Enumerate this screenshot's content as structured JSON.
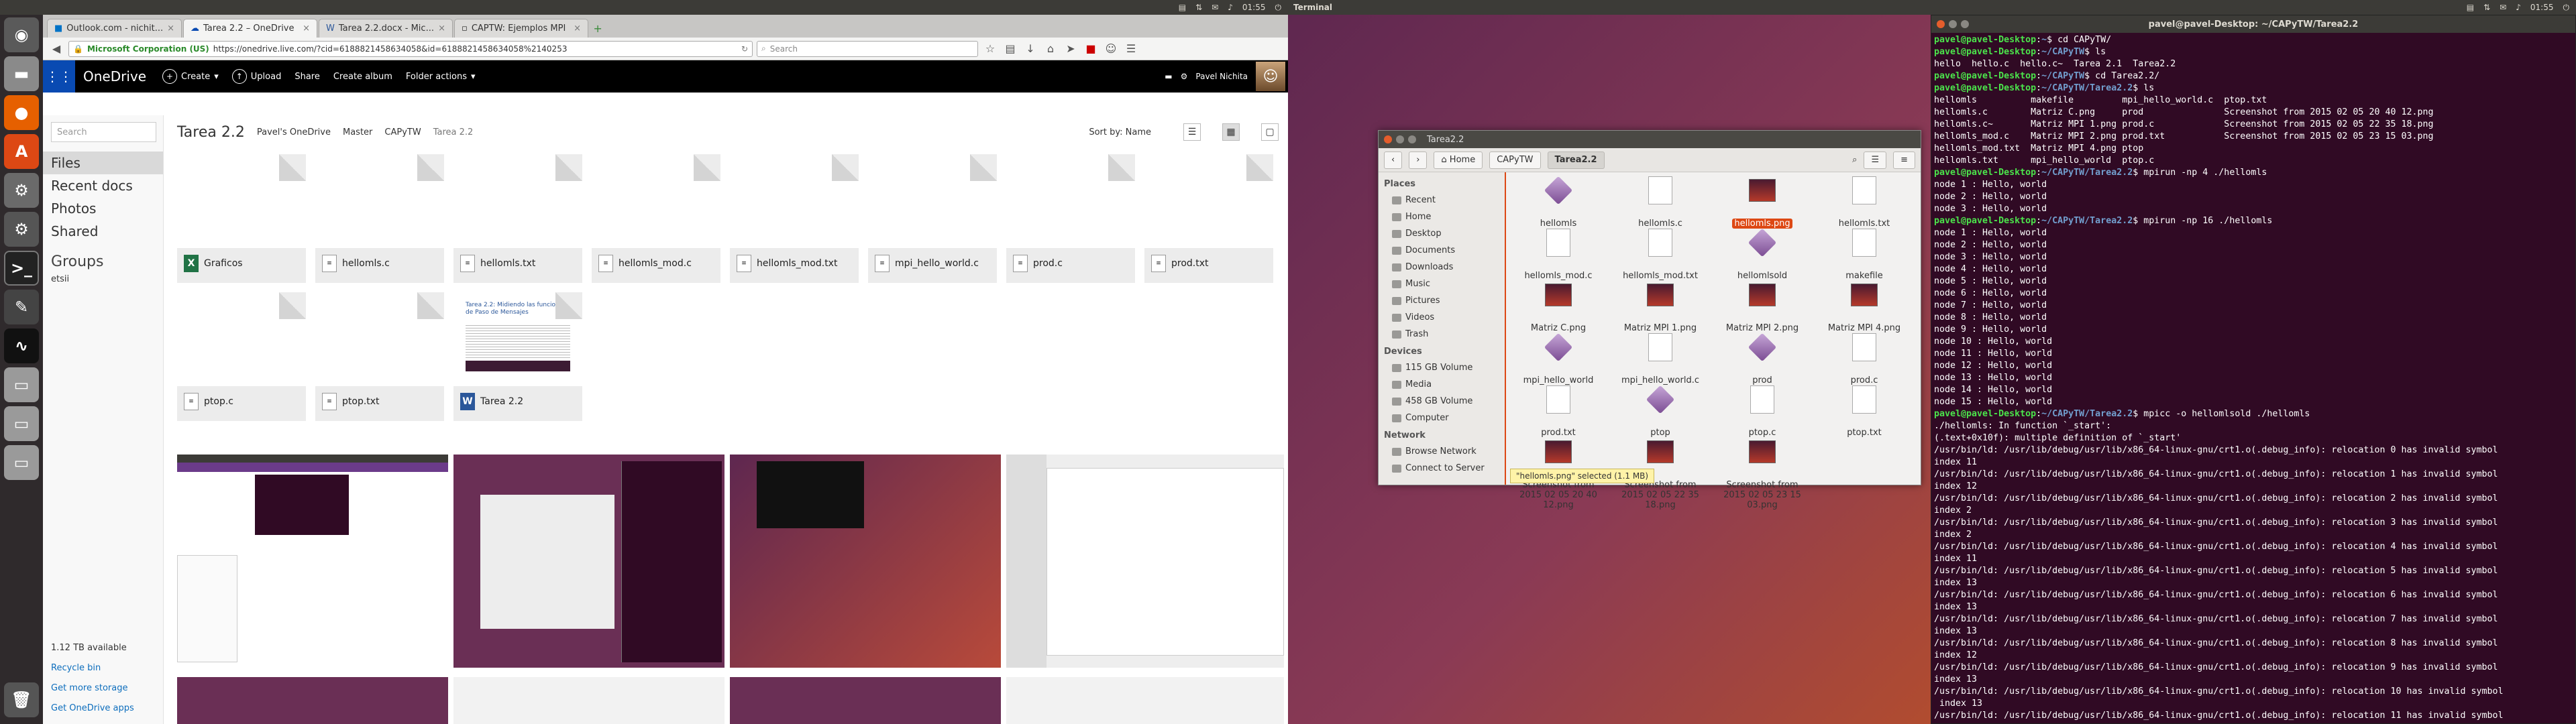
{
  "top_panel_right": {
    "time": "01:55",
    "app": "Terminal"
  },
  "top_panel_left": {
    "time": "01:55"
  },
  "browser": {
    "tabs": [
      {
        "label": "Outlook.com - nichit...",
        "active": false
      },
      {
        "label": "Tarea 2.2 – OneDrive",
        "active": true
      },
      {
        "label": "Tarea 2.2.docx - Mic...",
        "active": false
      },
      {
        "label": "CAPTW: Ejemplos MPI",
        "active": false
      }
    ],
    "new_tab": "+",
    "cert": "Microsoft Corporation (US)",
    "url": "https://onedrive.live.com/?cid=6188821458634058&id=6188821458634058%2140253",
    "search_placeholder": "Search"
  },
  "onedrive": {
    "brand": "OneDrive",
    "commands": [
      {
        "icon": "+",
        "label": "Create"
      },
      {
        "icon": "↑",
        "label": "Upload"
      },
      {
        "icon": "",
        "label": "Share"
      },
      {
        "icon": "",
        "label": "Create album"
      },
      {
        "icon": "",
        "label": "Folder actions"
      }
    ],
    "user": "Pavel Nichita",
    "search_placeholder": "Search",
    "nav": [
      {
        "label": "Files",
        "selected": true
      },
      {
        "label": "Recent docs",
        "selected": false
      },
      {
        "label": "Photos",
        "selected": false
      },
      {
        "label": "Shared",
        "selected": false
      }
    ],
    "groups_heading": "Groups",
    "group_item": "etsii",
    "storage": "1.12 TB available",
    "footer_links": [
      "Recycle bin",
      "Get more storage",
      "Get OneDrive apps"
    ],
    "title": "Tarea 2.2",
    "breadcrumb": [
      "Pavel's OneDrive",
      "Master",
      "CAPyTW",
      "Tarea 2.2"
    ],
    "sort": "Sort by: Name",
    "files": [
      {
        "name": "Graficos",
        "type": "xl"
      },
      {
        "name": "hellomls.c",
        "type": "txt"
      },
      {
        "name": "hellomls.txt",
        "type": "txt"
      },
      {
        "name": "hellomls_mod.c",
        "type": "txt"
      },
      {
        "name": "hellomls_mod.txt",
        "type": "txt"
      },
      {
        "name": "mpi_hello_world.c",
        "type": "txt"
      },
      {
        "name": "prod.c",
        "type": "txt"
      },
      {
        "name": "prod.txt",
        "type": "txt"
      },
      {
        "name": "ptop.c",
        "type": "txt"
      },
      {
        "name": "ptop.txt",
        "type": "txt"
      },
      {
        "name": "Tarea 2.2",
        "type": "wd"
      }
    ],
    "doc_preview_title": "Tarea 2.2: Midiendo las funciones de Paso de Mensajes"
  },
  "nautilus": {
    "title": "Tarea2.2",
    "path": [
      "Home",
      "CAPyTW",
      "Tarea2.2"
    ],
    "places_heading": "Places",
    "places": [
      "Recent",
      "Home",
      "Desktop",
      "Documents",
      "Downloads",
      "Music",
      "Pictures",
      "Videos",
      "Trash"
    ],
    "devices_heading": "Devices",
    "devices": [
      "115 GB Volume",
      "Media",
      "458 GB Volume",
      "Computer"
    ],
    "network_heading": "Network",
    "network": [
      "Browse Network",
      "Connect to Server"
    ],
    "files": [
      {
        "name": "hellomls",
        "kind": "exe"
      },
      {
        "name": "hellomls.c",
        "kind": "txt"
      },
      {
        "name": "hellomls.png",
        "kind": "img",
        "selected": true
      },
      {
        "name": "hellomls.txt",
        "kind": "txt"
      },
      {
        "name": "hellomls_mod.c",
        "kind": "txt"
      },
      {
        "name": "hellomls_mod.txt",
        "kind": "txt"
      },
      {
        "name": "hellomlsold",
        "kind": "exe"
      },
      {
        "name": "makefile",
        "kind": "txt"
      },
      {
        "name": "Matriz C.png",
        "kind": "img"
      },
      {
        "name": "Matriz MPI 1.png",
        "kind": "img"
      },
      {
        "name": "Matriz MPI 2.png",
        "kind": "img"
      },
      {
        "name": "Matriz MPI 4.png",
        "kind": "img"
      },
      {
        "name": "mpi_hello_world",
        "kind": "exe"
      },
      {
        "name": "mpi_hello_world.c",
        "kind": "txt"
      },
      {
        "name": "prod",
        "kind": "exe"
      },
      {
        "name": "prod.c",
        "kind": "txt"
      },
      {
        "name": "prod.txt",
        "kind": "txt"
      },
      {
        "name": "ptop",
        "kind": "exe"
      },
      {
        "name": "ptop.c",
        "kind": "txt"
      },
      {
        "name": "ptop.txt",
        "kind": "txt"
      },
      {
        "name": "Screenshot from 2015 02 05 20 40 12.png",
        "kind": "img"
      },
      {
        "name": "Screenshot from 2015 02 05 22 35 18.png",
        "kind": "img"
      },
      {
        "name": "Screenshot from 2015 02 05 23 15 03.png",
        "kind": "img"
      }
    ],
    "status": "\"hellomls.png\" selected (1.1 MB)"
  },
  "terminal": {
    "title": "pavel@pavel-Desktop: ~/CAPyTW/Tarea2.2",
    "lines": [
      "pavel@pavel-Desktop:~$ cd CAPyTW/",
      "pavel@pavel-Desktop:~/CAPyTW$ ls",
      "hello  hello.c  hello.c~  Tarea 2.1  Tarea2.2",
      "pavel@pavel-Desktop:~/CAPyTW$ cd Tarea2.2/",
      "pavel@pavel-Desktop:~/CAPyTW/Tarea2.2$ ls",
      "hellomls          makefile         mpi_hello_world.c  ptop.txt",
      "hellomls.c        Matriz C.png     prod               Screenshot from 2015 02 05 20 40 12.png",
      "hellomls.c~       Matriz MPI 1.png prod.c             Screenshot from 2015 02 05 22 35 18.png",
      "hellomls_mod.c    Matriz MPI 2.png prod.txt           Screenshot from 2015 02 05 23 15 03.png",
      "hellomls_mod.txt  Matriz MPI 4.png ptop",
      "hellomls.txt      mpi_hello_world  ptop.c",
      "pavel@pavel-Desktop:~/CAPyTW/Tarea2.2$ mpirun -np 4 ./hellomls",
      "node 1 : Hello, world",
      "node 2 : Hello, world",
      "node 3 : Hello, world",
      "pavel@pavel-Desktop:~/CAPyTW/Tarea2.2$ mpirun -np 16 ./hellomls",
      "node 1 : Hello, world",
      "node 2 : Hello, world",
      "node 3 : Hello, world",
      "node 4 : Hello, world",
      "node 5 : Hello, world",
      "node 6 : Hello, world",
      "node 7 : Hello, world",
      "node 8 : Hello, world",
      "node 9 : Hello, world",
      "node 10 : Hello, world",
      "node 11 : Hello, world",
      "node 12 : Hello, world",
      "node 13 : Hello, world",
      "node 14 : Hello, world",
      "node 15 : Hello, world",
      "pavel@pavel-Desktop:~/CAPyTW/Tarea2.2$ mpicc -o hellomlsold ./hellomls",
      "./hellomls: In function `_start':",
      "(.text+0x10f): multiple definition of `_start'",
      "/usr/bin/ld: /usr/lib/debug/usr/lib/x86_64-linux-gnu/crt1.o(.debug_info): relocation 0 has invalid symbol",
      "index 11",
      "/usr/bin/ld: /usr/lib/debug/usr/lib/x86_64-linux-gnu/crt1.o(.debug_info): relocation 1 has invalid symbol",
      "index 12",
      "/usr/bin/ld: /usr/lib/debug/usr/lib/x86_64-linux-gnu/crt1.o(.debug_info): relocation 2 has invalid symbol",
      "index 2",
      "/usr/bin/ld: /usr/lib/debug/usr/lib/x86_64-linux-gnu/crt1.o(.debug_info): relocation 3 has invalid symbol",
      "index 2",
      "/usr/bin/ld: /usr/lib/debug/usr/lib/x86_64-linux-gnu/crt1.o(.debug_info): relocation 4 has invalid symbol",
      "index 11",
      "/usr/bin/ld: /usr/lib/debug/usr/lib/x86_64-linux-gnu/crt1.o(.debug_info): relocation 5 has invalid symbol",
      "index 13",
      "/usr/bin/ld: /usr/lib/debug/usr/lib/x86_64-linux-gnu/crt1.o(.debug_info): relocation 6 has invalid symbol",
      "index 13",
      "/usr/bin/ld: /usr/lib/debug/usr/lib/x86_64-linux-gnu/crt1.o(.debug_info): relocation 7 has invalid symbol",
      "index 13",
      "/usr/bin/ld: /usr/lib/debug/usr/lib/x86_64-linux-gnu/crt1.o(.debug_info): relocation 8 has invalid symbol",
      "index 12",
      "/usr/bin/ld: /usr/lib/debug/usr/lib/x86_64-linux-gnu/crt1.o(.debug_info): relocation 9 has invalid symbol",
      "index 13",
      "/usr/bin/ld: /usr/lib/debug/usr/lib/x86_64-linux-gnu/crt1.o(.debug_info): relocation 10 has invalid symbol",
      " index 13",
      "/usr/bin/ld: /usr/lib/debug/usr/lib/x86_64-linux-gnu/crt1.o(.debug_info): relocation 11 has invalid symbol"
    ]
  }
}
